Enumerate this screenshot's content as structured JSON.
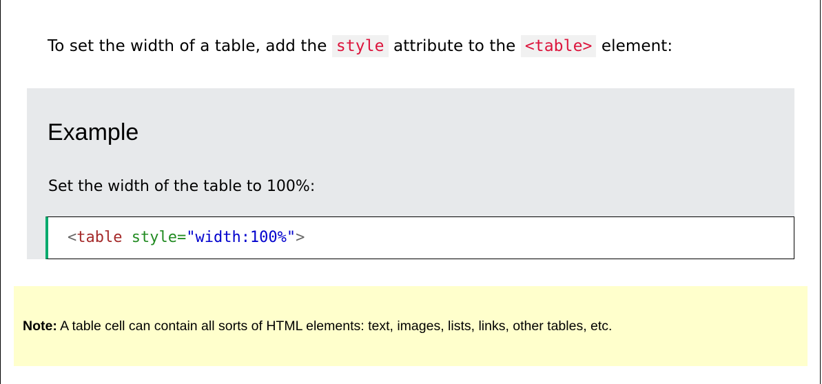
{
  "intro": {
    "text_before": "To set the width of a table, add the ",
    "code_attr": "style",
    "text_middle": " attribute to the ",
    "code_element": "<table>",
    "text_after": " element:"
  },
  "example": {
    "heading": "Example",
    "description": "Set the width of the table to 100%:",
    "code": {
      "open_bracket": "<",
      "tag": "table",
      "space": " ",
      "attribute": "style",
      "equals": "=",
      "value": "\"width:100%\"",
      "close_bracket": ">"
    }
  },
  "note": {
    "label": "Note:",
    "text": " A table cell can contain all sorts of HTML elements: text, images, lists, links, other tables, etc."
  },
  "colors": {
    "inline_code": "#dc143c",
    "inline_code_bg": "#f1f1f1",
    "example_bg": "#e7e9eb",
    "code_accent": "#04aa6d",
    "note_bg": "#ffffcc"
  }
}
